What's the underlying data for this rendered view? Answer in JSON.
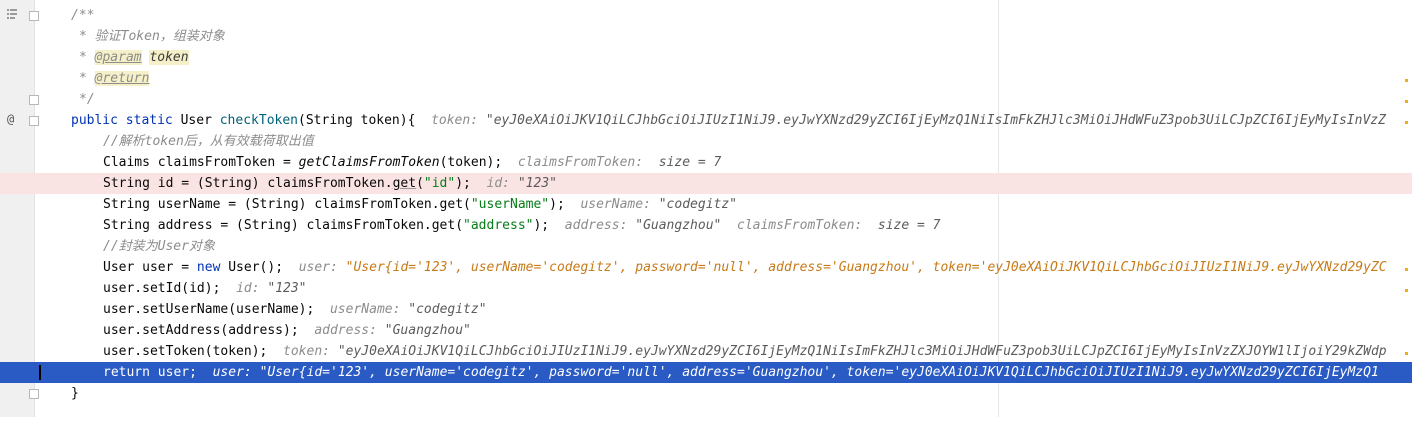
{
  "gutter": {
    "structure_icon": "structure-icon",
    "override_icon": "@",
    "breakpoint_icon": "breakpoint-icon"
  },
  "doc": {
    "open": "/**",
    "line1_star": "* ",
    "line1_text": "验证Token，组装对象",
    "param_tag": "@param",
    "param_name": "token",
    "return_tag": "@return",
    "close": "*/"
  },
  "sig": {
    "mod1": "public",
    "mod2": "static",
    "type": " User ",
    "name": "checkToken",
    "params": "(String token){",
    "hint_label": "token: ",
    "hint_value": "\"eyJ0eXAiOiJKV1QiLCJhbGciOiJIUzI1NiJ9.eyJwYXNzd29yZCI6IjEyMzQ1NiIsImFkZHJlc3MiOiJHdWFuZ3pob3UiLCJpZCI6IjEyMyIsInVzZ"
  },
  "lines": {
    "c1": "//解析token后，从有效载荷取出值",
    "claims_a": "Claims claimsFromToken = ",
    "claims_call": "getClaimsFromToken",
    "claims_b": "(token);",
    "claims_hint_label": "claimsFromToken:  ",
    "claims_hint_value": "size = 7",
    "id_a": "String id = (String) claimsFromToken.",
    "id_get": "get",
    "id_b": "(",
    "id_str": "\"id\"",
    "id_c": ");",
    "id_hint_label": "id: ",
    "id_hint_value": "\"123\"",
    "un_a": "String userName = (String) claimsFromToken.get(",
    "un_str": "\"userName\"",
    "un_b": ");",
    "un_hint_label": "userName: ",
    "un_hint_value": "\"codegitz\"",
    "ad_a": "String address = (String) claimsFromToken.get(",
    "ad_str": "\"address\"",
    "ad_b": ");",
    "ad_hint_label": "address: ",
    "ad_hint_value": "\"Guangzhou\"",
    "ad_hint2_label": "claimsFromToken:  ",
    "ad_hint2_value": "size = 7",
    "c2": "//封装为User对象",
    "nu_a": "User user = ",
    "nu_kw": "new",
    "nu_b": " User();",
    "nu_hint_label": "user: ",
    "nu_hint_value": "\"User{id='123', userName='codegitz', password='null', address='Guangzhou', token='eyJ0eXAiOiJKV1QiLCJhbGciOiJIUzI1NiJ9.eyJwYXNzd29yZC",
    "sid_a": "user.setId(id);",
    "sid_hint_label": "id: ",
    "sid_hint_value": "\"123\"",
    "sun_a": "user.setUserName(userName);",
    "sun_hint_label": "userName: ",
    "sun_hint_value": "\"codegitz\"",
    "sad_a": "user.setAddress(address);",
    "sad_hint_label": "address: ",
    "sad_hint_value": "\"Guangzhou\"",
    "stk_a": "user.setToken(token);",
    "stk_hint_label": "token: ",
    "stk_hint_value": "\"eyJ0eXAiOiJKV1QiLCJhbGciOiJIUzI1NiJ9.eyJwYXNzd29yZCI6IjEyMzQ1NiIsImFkZHJlc3MiOiJHdWFuZ3pob3UiLCJpZCI6IjEyMyIsInVzZXJOYW1lIjoiY29kZWdp",
    "ret_kw": "return",
    "ret_b": " user;",
    "ret_hint_label": "user: ",
    "ret_hint_value": "\"User{id='123', userName='codegitz', password='null', address='Guangzhou', token='eyJ0eXAiOiJKV1QiLCJhbGciOiJIUzI1NiJ9.eyJwYXNzd29yZCI6IjEyMzQ1",
    "close_brace": "}"
  },
  "colors": {
    "keyword": "#0033b3",
    "string": "#067d17",
    "method": "#00627a",
    "comment": "#8c8c8c",
    "hint_string": "#c77a18",
    "breakpoint_line": "#fae3e3",
    "execution_line": "#2a5ac4"
  }
}
